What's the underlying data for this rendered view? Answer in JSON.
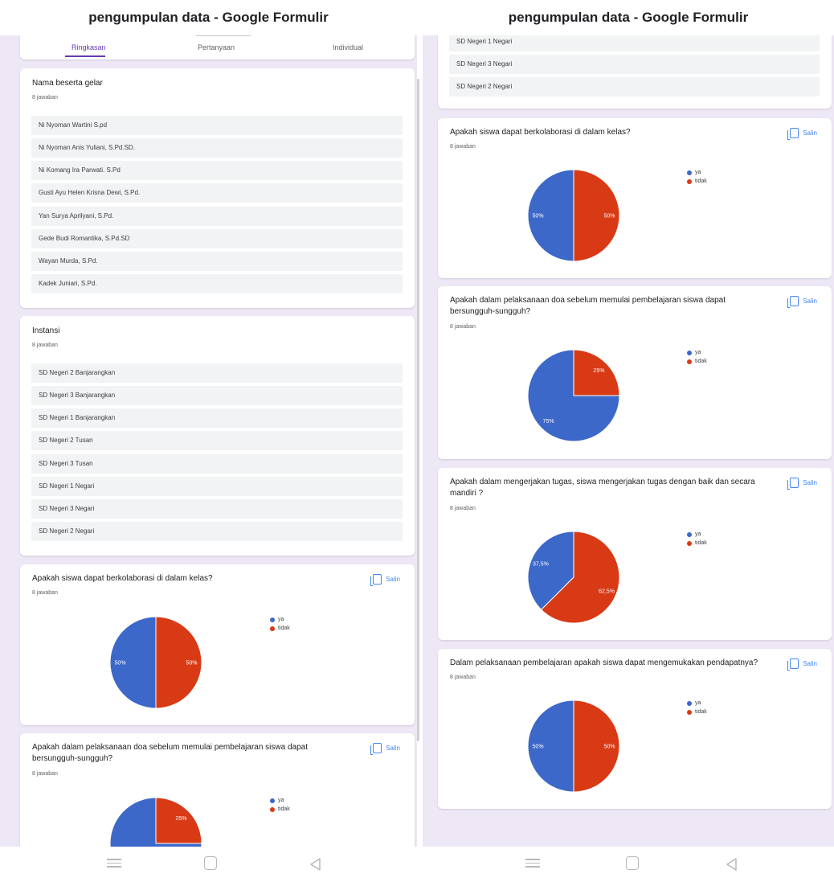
{
  "title": "pengumpulan data - Google Formulir",
  "tabs": [
    "Ringkasan",
    "Pertanyaan",
    "Individual"
  ],
  "colors": {
    "ya": "#3c68c9",
    "tidak": "#d83a16",
    "accent": "#673ab7",
    "link": "#4285f4"
  },
  "copy_label": "Salin",
  "legend": [
    "ya",
    "tidak"
  ],
  "q_nama": {
    "title": "Nama beserta gelar",
    "count": "8 jawaban",
    "responses": [
      "Ni Nyoman Wartini S.pd",
      "Ni Nyoman Anis Yuliani, S.Pd.SD.",
      "Ni Komang Ira Parwati. S.Pd",
      "Gusti Ayu Helen Krisna Dewi, S.Pd.",
      "Yan Surya Aprilyani, S.Pd.",
      "Gede Budi Romantika, S.Pd.SD",
      "Wayan Murda, S.Pd.",
      "Kadek Juniari, S.Pd."
    ]
  },
  "q_instansi": {
    "title": "Instansi",
    "count": "8 jawaban",
    "responses": [
      "SD Negeri 2 Banjarangkan",
      "SD Negeri 3 Banjarangkan",
      "SD Negeri 1 Banjarangkan",
      "SD Negeri 2 Tusan",
      "SD Negeri 3 Tusan",
      "SD Negeri 1 Negari",
      "SD Negeri 3 Negari",
      "SD Negeri 2 Negari"
    ]
  },
  "instansi_tail": [
    "SD Negeri 1 Negari",
    "SD Negeri 3 Negari",
    "SD Negeri 2 Negari"
  ],
  "q_kolaborasi": {
    "title": "Apakah siswa dapat berkolaborasi di dalam kelas?",
    "count": "8 jawaban"
  },
  "q_doa": {
    "title_line1": "Apakah dalam pelaksanaan doa sebelum memulai pembelajaran siswa dapat",
    "title_line2": "bersungguh-sungguh?",
    "count": "8 jawaban"
  },
  "q_tugas": {
    "title_line1": "Apakah dalam mengerjakan tugas, siswa mengerjakan tugas dengan baik dan secara",
    "title_line2": "mandiri ?",
    "count": "8 jawaban"
  },
  "q_pendapat": {
    "title": "Dalam pelaksanaan pembelajaran apakah siswa dapat mengemukakan pendapatnya?",
    "count": "8 jawaban"
  },
  "chart_data": [
    {
      "type": "pie",
      "question": "Apakah siswa dapat berkolaborasi di dalam kelas?",
      "categories": [
        "ya",
        "tidak"
      ],
      "values": [
        50,
        50
      ],
      "labels": [
        "50%",
        "50%"
      ]
    },
    {
      "type": "pie",
      "question": "Apakah dalam pelaksanaan doa sebelum memulai pembelajaran siswa dapat bersungguh-sungguh?",
      "categories": [
        "ya",
        "tidak"
      ],
      "values": [
        75,
        25
      ],
      "labels": [
        "75%",
        "25%"
      ]
    },
    {
      "type": "pie",
      "question": "Apakah dalam mengerjakan tugas, siswa mengerjakan tugas dengan baik dan secara mandiri ?",
      "categories": [
        "ya",
        "tidak"
      ],
      "values": [
        37.5,
        62.5
      ],
      "labels": [
        "37,5%",
        "62,5%"
      ]
    },
    {
      "type": "pie",
      "question": "Dalam pelaksanaan pembelajaran apakah siswa dapat mengemukakan pendapatnya?",
      "categories": [
        "ya",
        "tidak"
      ],
      "values": [
        50,
        50
      ],
      "labels": [
        "50%",
        "50%"
      ]
    }
  ]
}
